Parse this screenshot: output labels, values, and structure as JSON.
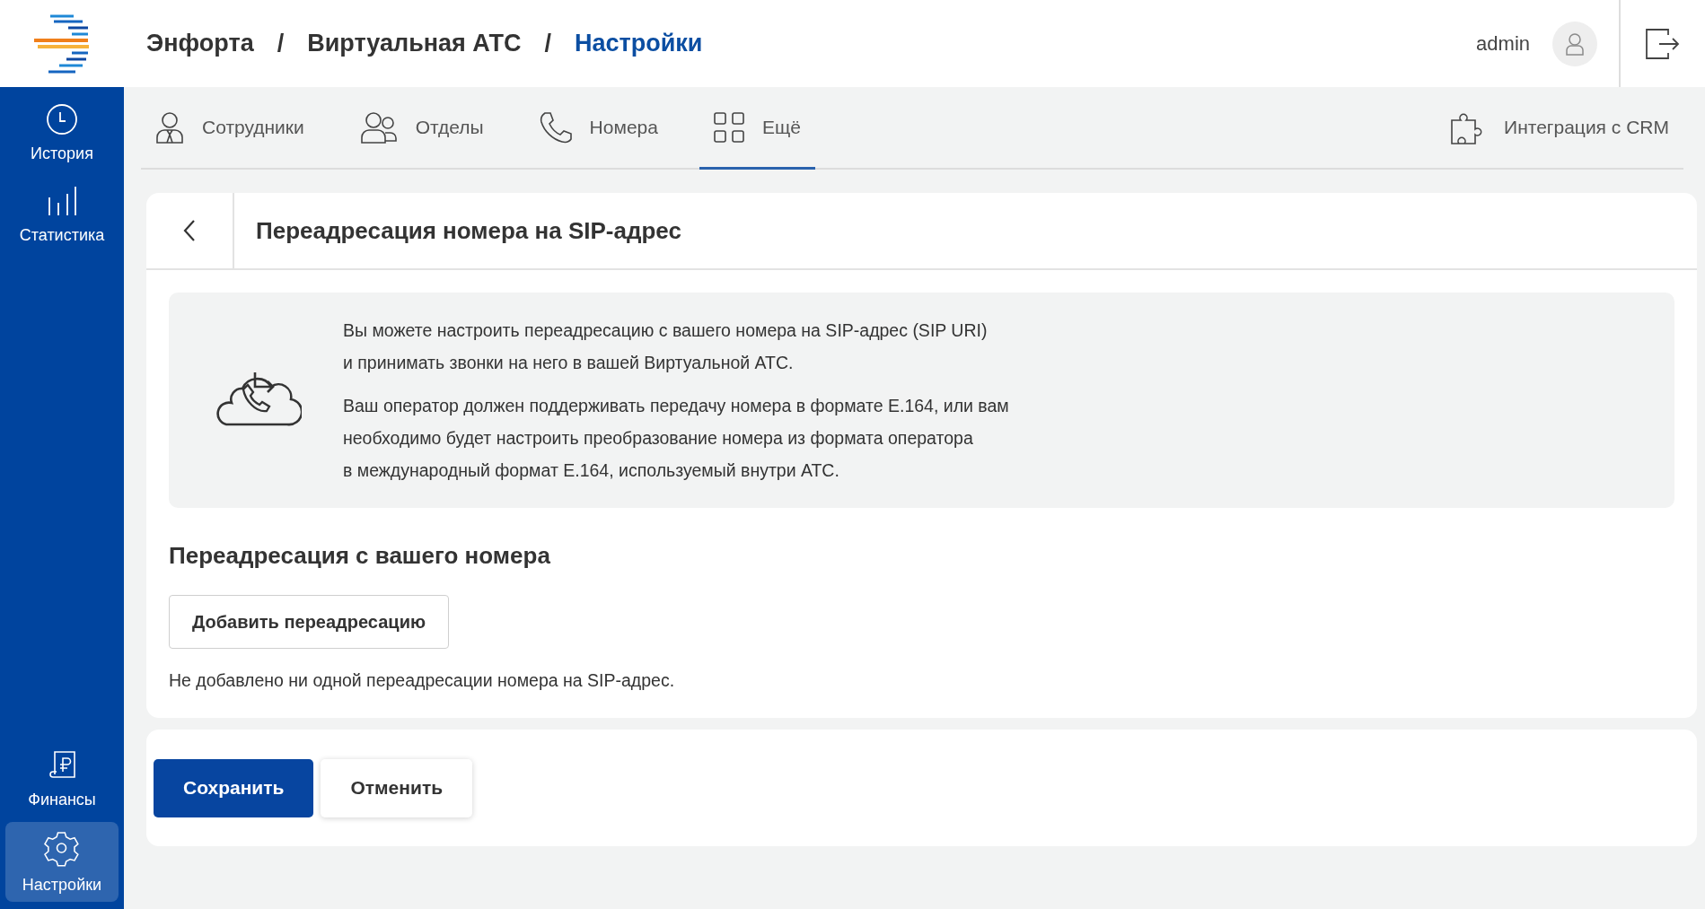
{
  "sidebar": {
    "top_items": [
      {
        "label": "История",
        "selected": false
      },
      {
        "label": "Статистика",
        "selected": false
      }
    ],
    "bottom_items": [
      {
        "label": "Финансы",
        "selected": false
      },
      {
        "label": "Настройки",
        "selected": true
      }
    ]
  },
  "breadcrumbs": [
    {
      "label": "Энфорта",
      "current": false
    },
    {
      "label": "Виртуальная АТС",
      "current": false
    },
    {
      "label": "Настройки",
      "current": true
    }
  ],
  "breadcrumb_separator": "/",
  "user": {
    "name": "admin"
  },
  "tabs": [
    {
      "label": "Сотрудники",
      "selected": false
    },
    {
      "label": "Отделы",
      "selected": false
    },
    {
      "label": "Номера",
      "selected": false
    },
    {
      "label": "Ещё",
      "selected": true
    }
  ],
  "crm_link": "Интеграция с CRM",
  "page_title": "Переадресация номера на SIP-адрес",
  "info": {
    "paragraphs": [
      [
        "Вы можете настроить переадресацию с вашего номера на SIP-адрес (SIP URI)",
        "и принимать звонки на него в вашей Виртуальной АТС."
      ],
      [
        "Ваш оператор должен поддерживать передачу номера в формате E.164, или вам",
        "необходимо будет настроить преобразование номера из формата оператора",
        "в международный формат E.164, используемый внутри АТС."
      ]
    ]
  },
  "section_title": "Переадресация с вашего номера",
  "add_button": "Добавить переадресацию",
  "empty_note": "Не добавлено ни одной переадресации номера на SIP-адрес.",
  "footer_buttons": [
    {
      "label": "Сохранить",
      "kind": "primary"
    },
    {
      "label": "Отменить",
      "kind": "secondary"
    }
  ]
}
